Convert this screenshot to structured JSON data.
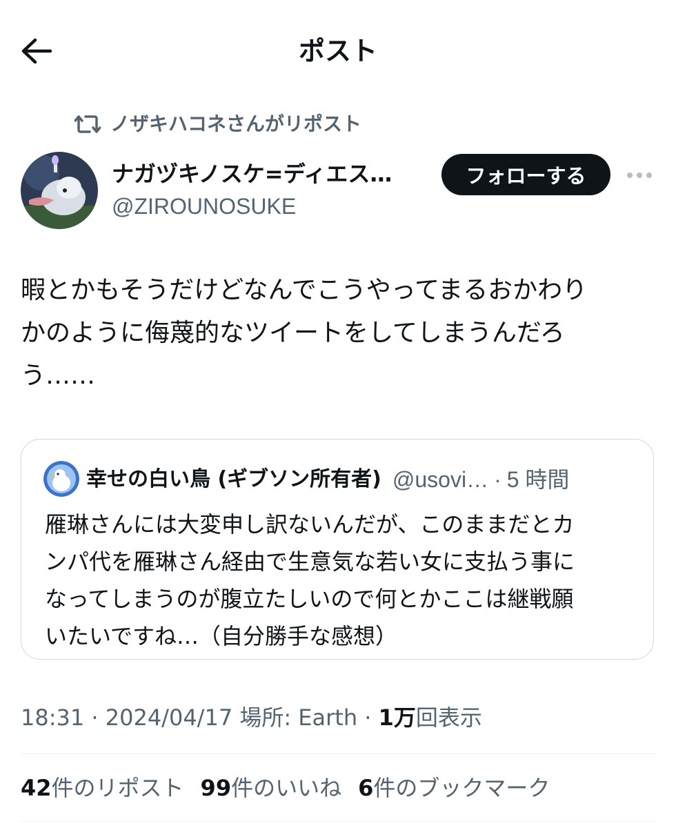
{
  "header": {
    "title": "ポスト",
    "back_icon": "arrow-left-icon"
  },
  "repost": {
    "text": "ノザキハコネさんがリポスト",
    "icon": "repost-icon"
  },
  "author": {
    "display_name": "ナガヅキノスケ=ディエス…",
    "handle": "@ZIROUNOSUKE",
    "follow_label": "フォローする",
    "more_icon": "more-dots-icon"
  },
  "tweet": {
    "lines": [
      "暇とかもそうだけどなんでこうやってまるおかわり",
      "かのように侮蔑的なツイートをしてしまうんだろ",
      "う……"
    ]
  },
  "quote": {
    "name": "幸せの白い鳥 (ギブソン所有者)",
    "handle": "@usovi…",
    "separator": "·",
    "time": "5 時間",
    "lines": [
      "雁琳さんには大変申し訳ないんだが、このままだとカ",
      "ンパ代を雁琳さん経由で生意気な若い女に支払う事に",
      "なってしまうのが腹立たしいので何とかここは継戦願",
      "いたいですね…（自分勝手な感想）"
    ]
  },
  "meta": {
    "time": "18:31",
    "sep1": "·",
    "date": "2024/04/17",
    "location": "場所: Earth",
    "sep2": "·",
    "views_count": "1万",
    "views_label": "回表示"
  },
  "stats": {
    "reposts_count": "42",
    "reposts_label": "件のリポスト",
    "likes_count": "99",
    "likes_label": "件のいいね",
    "bookmarks_count": "6",
    "bookmarks_label": "件のブックマーク"
  },
  "colors": {
    "text": "#0f1419",
    "secondary": "#536471",
    "border": "#cfd9de",
    "button_bg": "#0f1419"
  }
}
